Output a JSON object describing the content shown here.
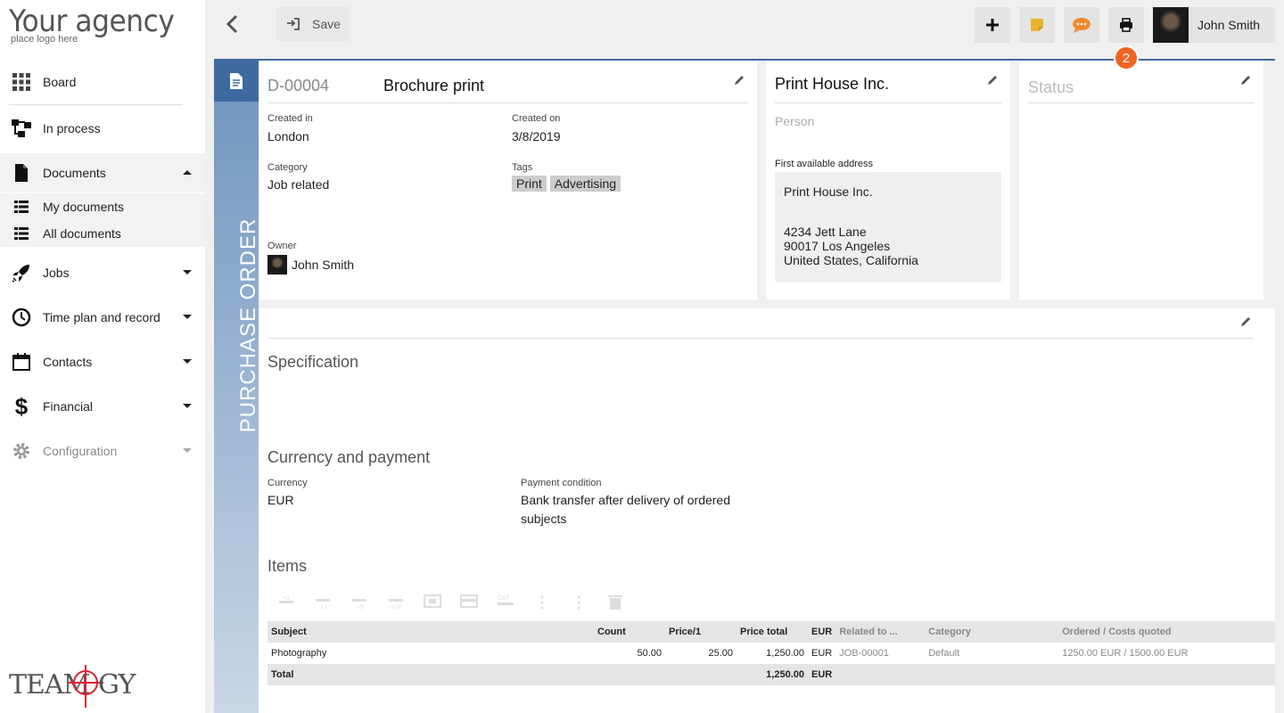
{
  "app": {
    "logo_title": "Your agency",
    "logo_sub": "place logo here",
    "footer_logo": "TEAMOGY"
  },
  "sidebar": {
    "items": [
      {
        "label": "Board",
        "icon": "grid-icon"
      },
      {
        "label": "In process",
        "icon": "flow-icon"
      },
      {
        "label": "Documents",
        "icon": "document-icon",
        "expanded": true
      },
      {
        "label": "My documents",
        "icon": "list-icon"
      },
      {
        "label": "All documents",
        "icon": "list-icon"
      },
      {
        "label": "Jobs",
        "icon": "rocket-icon"
      },
      {
        "label": "Time plan and record",
        "icon": "clock-icon"
      },
      {
        "label": "Contacts",
        "icon": "calendar-icon"
      },
      {
        "label": "Financial",
        "icon": "dollar-icon"
      },
      {
        "label": "Configuration",
        "icon": "gear-icon",
        "disabled": true
      }
    ]
  },
  "toolbar": {
    "save_label": "Save",
    "user_name": "John Smith",
    "badge_count": "2"
  },
  "doc": {
    "type_label": "PURCHASE ORDER",
    "number": "D-00004",
    "title": "Brochure print",
    "created_in_label": "Created in",
    "created_in": "London",
    "created_on_label": "Created on",
    "created_on": "3/8/2019",
    "category_label": "Category",
    "category": "Job related",
    "tags_label": "Tags",
    "tags": [
      "Print",
      "Advertising"
    ],
    "owner_label": "Owner",
    "owner": "John Smith"
  },
  "contact": {
    "company": "Print House Inc.",
    "person_placeholder": "Person",
    "address_label": "First available address",
    "address_lines": [
      "Print House Inc.",
      "",
      "4234  Jett Lane",
      "90017 Los Angeles",
      "United States, California"
    ]
  },
  "status": {
    "title": "Status"
  },
  "spec": {
    "title": "Specification"
  },
  "payment": {
    "title": "Currency and payment",
    "currency_label": "Currency",
    "currency": "EUR",
    "condition_label": "Payment condition",
    "condition_line1": "Bank transfer after delivery of ordered",
    "condition_line2": "subjects"
  },
  "items": {
    "title": "Items",
    "columns": [
      "Subject",
      "Count",
      "Price/1",
      "Price total",
      "EUR",
      "Related to ...",
      "Category",
      "Ordered / Costs quoted"
    ],
    "rows": [
      {
        "subject": "Photography",
        "count": "50.00",
        "price": "25.00",
        "total": "1,250.00",
        "cur": "EUR",
        "related": "JOB-00001",
        "category": "Default",
        "ordered": "1250.00 EUR / 1500.00 EUR"
      }
    ],
    "total_label": "Total",
    "total_value": "1,250.00",
    "total_cur": "EUR"
  }
}
